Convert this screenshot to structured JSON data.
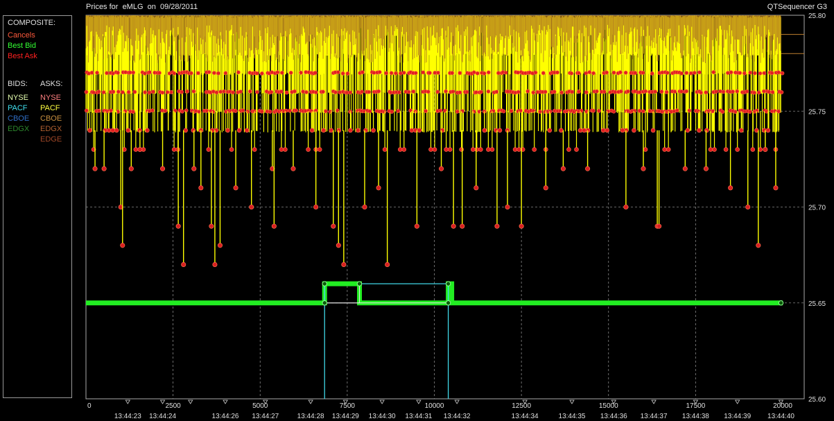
{
  "window": {
    "title": "Prices for  eMLG  on  09/28/2011",
    "app_name": "QTSequencer G3"
  },
  "legend": {
    "composite_heading": "COMPOSITE:",
    "composite_items": [
      {
        "label": "Cancels",
        "color": "#ff5a3c"
      },
      {
        "label": "Best Bid",
        "color": "#33ff33"
      },
      {
        "label": "Best Ask",
        "color": "#ff2020"
      }
    ],
    "bids_heading": "BIDS:",
    "asks_heading": "ASKS:",
    "bids": [
      {
        "label": "NYSE",
        "color": "#e6ffb0"
      },
      {
        "label": "PACF",
        "color": "#40e0f0"
      },
      {
        "label": "CBOE",
        "color": "#3070c8"
      },
      {
        "label": "EDGX",
        "color": "#2e8b2e"
      }
    ],
    "asks": [
      {
        "label": "NYSE",
        "color": "#ff8080"
      },
      {
        "label": "PACF",
        "color": "#ffff40"
      },
      {
        "label": "CBOE",
        "color": "#c89040"
      },
      {
        "label": "EDGX",
        "color": "#b06030"
      },
      {
        "label": "EDGE",
        "color": "#a04828"
      }
    ]
  },
  "chart_data": {
    "type": "line",
    "xlim": [
      0,
      20000
    ],
    "ylim": [
      25.6,
      25.8
    ],
    "x_ticks": [
      "0",
      "2500",
      "5000",
      "7500",
      "10000",
      "12500",
      "15000",
      "17500",
      "20000"
    ],
    "x_tick_values": [
      0,
      2500,
      5000,
      7500,
      10000,
      12500,
      15000,
      17500,
      20000
    ],
    "y_ticks": [
      "25.60",
      "25.65",
      "25.70",
      "25.75",
      "25.80"
    ],
    "y_tick_values": [
      25.6,
      25.65,
      25.7,
      25.75,
      25.8
    ],
    "time_labels": [
      "13:44:23",
      "13:44:24",
      "13:44:26",
      "13:44:27",
      "13:44:28",
      "13:44:29",
      "13:44:30",
      "13:44:31",
      "13:44:32",
      "13:44:34",
      "13:44:35",
      "13:44:36",
      "13:44:37",
      "13:44:38",
      "13:44:39",
      "13:44:40"
    ],
    "time_label_x": [
      1200,
      2200,
      4000,
      5150,
      6450,
      7450,
      8500,
      9550,
      10650,
      12600,
      13950,
      15150,
      16300,
      17500,
      18700,
      19950
    ],
    "grid": true,
    "series": [
      {
        "name": "Best Bid",
        "color": "#22ee22",
        "points": [
          [
            0,
            25.65
          ],
          [
            6850,
            25.65
          ],
          [
            6850,
            25.66
          ],
          [
            7850,
            25.66
          ],
          [
            7850,
            25.65
          ],
          [
            10400,
            25.65
          ],
          [
            10400,
            25.66
          ],
          [
            10500,
            25.66
          ],
          [
            10500,
            25.65
          ],
          [
            20000,
            25.65
          ]
        ]
      },
      {
        "name": "PACF",
        "color": "#40d8e8",
        "points": [
          [
            6850,
            25.6
          ],
          [
            6850,
            25.66
          ],
          [
            10400,
            25.66
          ],
          [
            10400,
            25.6
          ]
        ]
      }
    ],
    "ask_band": {
      "name": "Best Ask",
      "color": "#ffff00",
      "x_range": [
        0,
        20000
      ],
      "typical": 25.76,
      "max": 25.8,
      "min": 25.67
    },
    "ask_spikes": [
      {
        "x": 260,
        "y": 25.72
      },
      {
        "x": 520,
        "y": 25.72
      },
      {
        "x": 1000,
        "y": 25.7
      },
      {
        "x": 1050,
        "y": 25.68
      },
      {
        "x": 1300,
        "y": 25.72
      },
      {
        "x": 1550,
        "y": 25.73
      },
      {
        "x": 2200,
        "y": 25.72
      },
      {
        "x": 2650,
        "y": 25.69
      },
      {
        "x": 2800,
        "y": 25.67
      },
      {
        "x": 3100,
        "y": 25.72
      },
      {
        "x": 3300,
        "y": 25.71
      },
      {
        "x": 3600,
        "y": 25.69
      },
      {
        "x": 3700,
        "y": 25.67
      },
      {
        "x": 3850,
        "y": 25.68
      },
      {
        "x": 4300,
        "y": 25.71
      },
      {
        "x": 4750,
        "y": 25.7
      },
      {
        "x": 5350,
        "y": 25.72
      },
      {
        "x": 5400,
        "y": 25.69
      },
      {
        "x": 5950,
        "y": 25.72
      },
      {
        "x": 6600,
        "y": 25.7
      },
      {
        "x": 7100,
        "y": 25.69
      },
      {
        "x": 7400,
        "y": 25.67
      },
      {
        "x": 7250,
        "y": 25.68
      },
      {
        "x": 8000,
        "y": 25.7
      },
      {
        "x": 8400,
        "y": 25.71
      },
      {
        "x": 8650,
        "y": 25.67
      },
      {
        "x": 9500,
        "y": 25.69
      },
      {
        "x": 10200,
        "y": 25.72
      },
      {
        "x": 10550,
        "y": 25.69
      },
      {
        "x": 10800,
        "y": 25.69
      },
      {
        "x": 11200,
        "y": 25.71
      },
      {
        "x": 11800,
        "y": 25.69
      },
      {
        "x": 12100,
        "y": 25.7
      },
      {
        "x": 12500,
        "y": 25.69
      },
      {
        "x": 13200,
        "y": 25.71
      },
      {
        "x": 13700,
        "y": 25.72
      },
      {
        "x": 14400,
        "y": 25.72
      },
      {
        "x": 15500,
        "y": 25.7
      },
      {
        "x": 16000,
        "y": 25.72
      },
      {
        "x": 16400,
        "y": 25.69
      },
      {
        "x": 16450,
        "y": 25.69
      },
      {
        "x": 17200,
        "y": 25.72
      },
      {
        "x": 17800,
        "y": 25.72
      },
      {
        "x": 18500,
        "y": 25.71
      },
      {
        "x": 19000,
        "y": 25.7
      },
      {
        "x": 19300,
        "y": 25.68
      },
      {
        "x": 19500,
        "y": 25.73
      },
      {
        "x": 19800,
        "y": 25.71
      }
    ],
    "bid_markers": [
      {
        "x": 6850,
        "y": 25.65
      },
      {
        "x": 6850,
        "y": 25.66
      },
      {
        "x": 7850,
        "y": 25.66
      },
      {
        "x": 10400,
        "y": 25.66
      },
      {
        "x": 10400,
        "y": 25.65
      },
      {
        "x": 19950,
        "y": 25.65
      }
    ],
    "time_marks": [
      1200,
      2200,
      3000,
      4000,
      5150,
      6450,
      7450,
      8500,
      9550,
      10650,
      12600,
      13950,
      15150,
      16300,
      17500,
      18700,
      19950
    ]
  }
}
